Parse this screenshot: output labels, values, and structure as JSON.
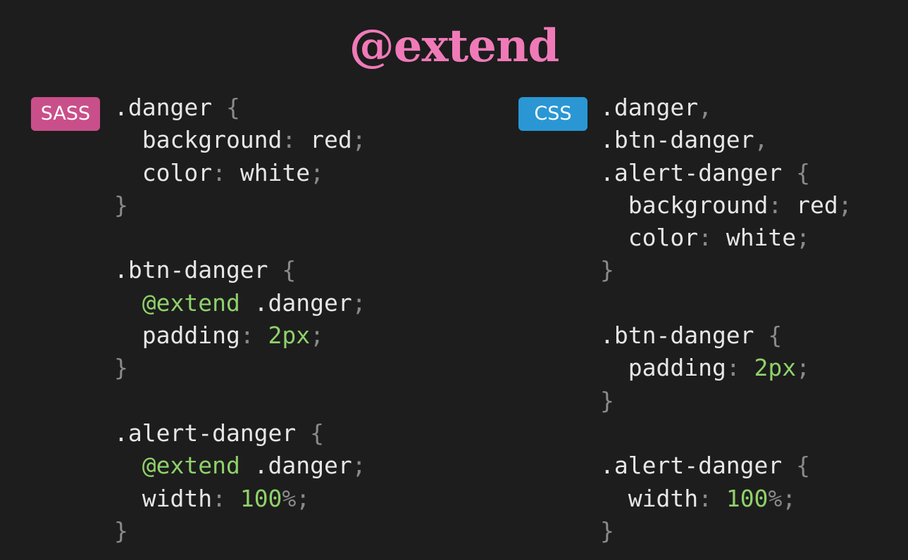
{
  "title": "@extend",
  "badges": {
    "sass": "SASS",
    "css": "CSS"
  },
  "panels": {
    "sass": [
      [
        {
          "t": ".danger",
          "c": "d"
        },
        {
          "t": " {",
          "c": "p"
        }
      ],
      [
        {
          "t": "  background",
          "c": "d"
        },
        {
          "t": ":",
          "c": "p"
        },
        {
          "t": " red",
          "c": "d"
        },
        {
          "t": ";",
          "c": "p"
        }
      ],
      [
        {
          "t": "  color",
          "c": "d"
        },
        {
          "t": ":",
          "c": "p"
        },
        {
          "t": " white",
          "c": "d"
        },
        {
          "t": ";",
          "c": "p"
        }
      ],
      [
        {
          "t": "}",
          "c": "p"
        }
      ],
      [],
      [
        {
          "t": ".btn-danger",
          "c": "d"
        },
        {
          "t": " {",
          "c": "p"
        }
      ],
      [
        {
          "t": "  @extend",
          "c": "g"
        },
        {
          "t": " .danger",
          "c": "d"
        },
        {
          "t": ";",
          "c": "p"
        }
      ],
      [
        {
          "t": "  padding",
          "c": "d"
        },
        {
          "t": ":",
          "c": "p"
        },
        {
          "t": " 2px",
          "c": "g"
        },
        {
          "t": ";",
          "c": "p"
        }
      ],
      [
        {
          "t": "}",
          "c": "p"
        }
      ],
      [],
      [
        {
          "t": ".alert-danger",
          "c": "d"
        },
        {
          "t": " {",
          "c": "p"
        }
      ],
      [
        {
          "t": "  @extend",
          "c": "g"
        },
        {
          "t": " .danger",
          "c": "d"
        },
        {
          "t": ";",
          "c": "p"
        }
      ],
      [
        {
          "t": "  width",
          "c": "d"
        },
        {
          "t": ":",
          "c": "p"
        },
        {
          "t": " 100",
          "c": "g"
        },
        {
          "t": "%;",
          "c": "p"
        }
      ],
      [
        {
          "t": "}",
          "c": "p"
        }
      ]
    ],
    "css": [
      [
        {
          "t": ".danger",
          "c": "d"
        },
        {
          "t": ",",
          "c": "p"
        }
      ],
      [
        {
          "t": ".btn-danger",
          "c": "d"
        },
        {
          "t": ",",
          "c": "p"
        }
      ],
      [
        {
          "t": ".alert-danger",
          "c": "d"
        },
        {
          "t": " {",
          "c": "p"
        }
      ],
      [
        {
          "t": "  background",
          "c": "d"
        },
        {
          "t": ":",
          "c": "p"
        },
        {
          "t": " red",
          "c": "d"
        },
        {
          "t": ";",
          "c": "p"
        }
      ],
      [
        {
          "t": "  color",
          "c": "d"
        },
        {
          "t": ":",
          "c": "p"
        },
        {
          "t": " white",
          "c": "d"
        },
        {
          "t": ";",
          "c": "p"
        }
      ],
      [
        {
          "t": "}",
          "c": "p"
        }
      ],
      [],
      [
        {
          "t": ".btn-danger",
          "c": "d"
        },
        {
          "t": " {",
          "c": "p"
        }
      ],
      [
        {
          "t": "  padding",
          "c": "d"
        },
        {
          "t": ":",
          "c": "p"
        },
        {
          "t": " 2px",
          "c": "g"
        },
        {
          "t": ";",
          "c": "p"
        }
      ],
      [
        {
          "t": "}",
          "c": "p"
        }
      ],
      [],
      [
        {
          "t": ".alert-danger",
          "c": "d"
        },
        {
          "t": " {",
          "c": "p"
        }
      ],
      [
        {
          "t": "  width",
          "c": "d"
        },
        {
          "t": ":",
          "c": "p"
        },
        {
          "t": " 100",
          "c": "g"
        },
        {
          "t": "%;",
          "c": "p"
        }
      ],
      [
        {
          "t": "}",
          "c": "p"
        }
      ]
    ]
  },
  "colors": {
    "background": "#1d1d1d",
    "title": "#f07ab8",
    "sass_badge": "#c94f8a",
    "css_badge": "#2a97d4",
    "code_text": "#e6e6e6",
    "code_punct": "#8a8a8a",
    "code_green": "#8fd16a"
  }
}
